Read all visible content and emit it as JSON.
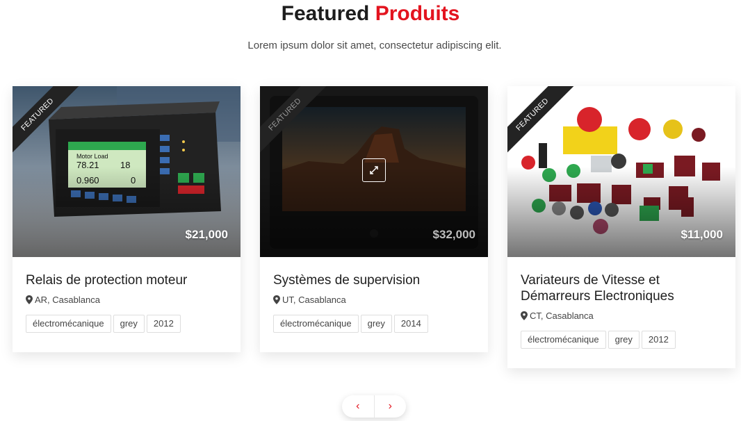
{
  "section": {
    "title_main": "Featured",
    "title_accent": "Produits",
    "subtitle": "Lorem ipsum dolor sit amet, consectetur adipiscing elit."
  },
  "products": [
    {
      "badge": "FEATURED",
      "price": "$21,000",
      "title": "Relais de protection moteur",
      "location": "AR, Casablanca",
      "tags": [
        "électromécanique",
        "grey",
        "2012"
      ]
    },
    {
      "badge": "FEATURED",
      "price": "$32,000",
      "title": "Systèmes de supervision",
      "location": "UT, Casablanca",
      "tags": [
        "électromécanique",
        "grey",
        "2014"
      ]
    },
    {
      "badge": "FEATURED",
      "price": "$11,000",
      "title": "Variateurs de Vitesse et Démarreurs Electroniques",
      "location": "CT, Casablanca",
      "tags": [
        "électromécanique",
        "grey",
        "2012"
      ]
    }
  ],
  "pager": {
    "prev": "‹",
    "next": "›"
  },
  "colors": {
    "accent": "#e3141f",
    "ribbon": "#232323"
  }
}
